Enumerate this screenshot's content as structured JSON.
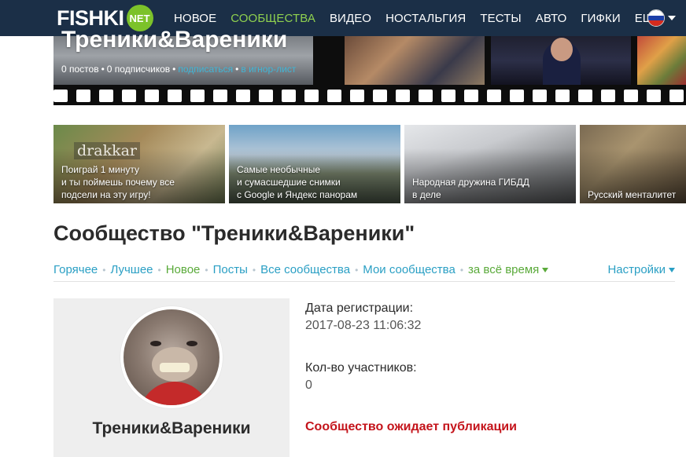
{
  "header": {
    "logo_text": "FISHKI",
    "logo_badge": "NET",
    "nav": [
      {
        "label": "НОВОЕ",
        "active": false
      },
      {
        "label": "СООБЩЕСТВА",
        "active": true
      },
      {
        "label": "ВИДЕО",
        "active": false
      },
      {
        "label": "НОСТАЛЬГИЯ",
        "active": false
      },
      {
        "label": "ТЕСТЫ",
        "active": false
      },
      {
        "label": "АВТО",
        "active": false
      },
      {
        "label": "ГИФКИ",
        "active": false
      },
      {
        "label": "ЕЩЁ",
        "active": false
      }
    ],
    "language_flag": "russia-flag-icon",
    "colors": {
      "nav_bg": "#1b2f47",
      "active": "#8fd14f"
    }
  },
  "banner": {
    "title": "Треники&Вареники",
    "posts": "0 постов",
    "subscribers": "0 подписчиков",
    "subscribe": "подписаться",
    "ignore": "в игнор-лист"
  },
  "promos": [
    {
      "overlay": "drakkar",
      "caption": "Поиграй 1 минуту\nи ты поймешь почему все\nподсели на эту игру!"
    },
    {
      "caption": "Самые необычные\nи сумасшедшие снимки\nс Google и Яндекс панорам"
    },
    {
      "caption": "Народная дружина ГИБДД\nв деле"
    },
    {
      "caption": "Русский менталитет"
    }
  ],
  "page": {
    "title": "Сообщество \"Треники&Вареники\""
  },
  "tabs": {
    "items": [
      {
        "label": "Горячее",
        "color": "blue"
      },
      {
        "label": "Лучшее",
        "color": "blue"
      },
      {
        "label": "Новое",
        "color": "green"
      },
      {
        "label": "Посты",
        "color": "blue"
      },
      {
        "label": "Все сообщества",
        "color": "blue"
      },
      {
        "label": "Мои сообщества",
        "color": "blue"
      }
    ],
    "period": "за всё время",
    "settings": "Настройки"
  },
  "profile": {
    "name": "Треники&Вареники",
    "reg_label": "Дата регистрации:",
    "reg_value": "2017-08-23 11:06:32",
    "members_label": "Кол-во участников:",
    "members_value": "0",
    "status": "Сообщество ожидает публикации",
    "status_color": "#c4141b"
  }
}
